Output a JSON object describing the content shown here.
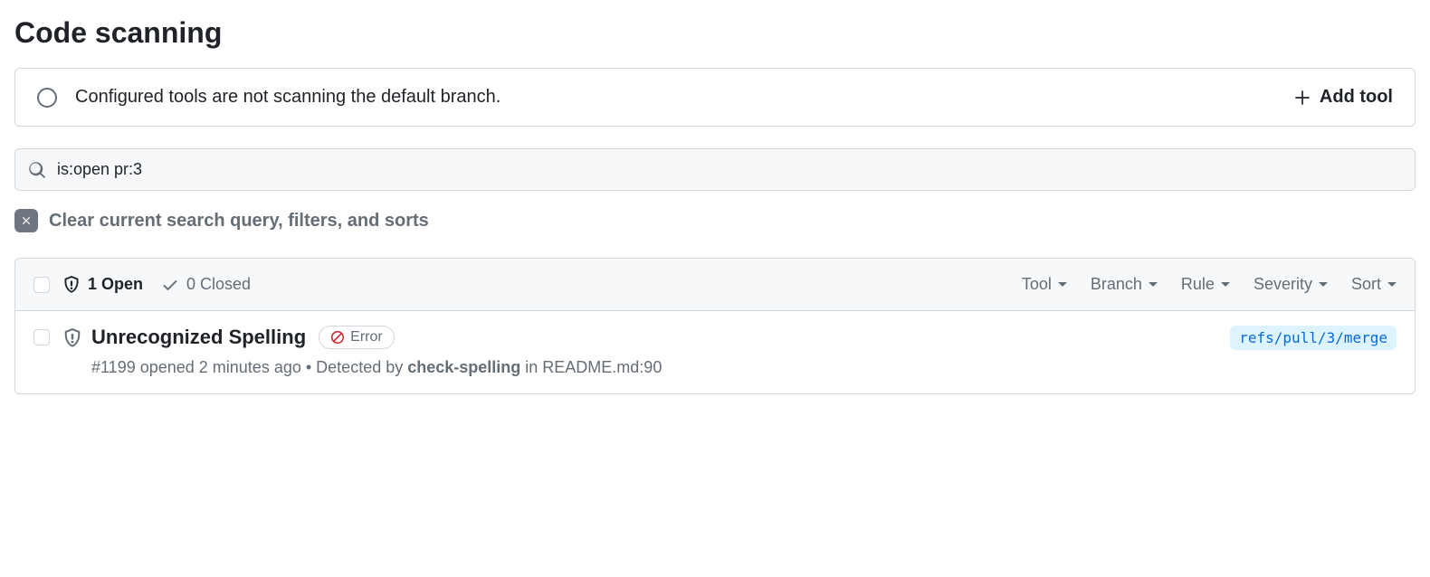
{
  "page": {
    "title": "Code scanning"
  },
  "banner": {
    "message": "Configured tools are not scanning the default branch.",
    "add_tool_label": "Add tool"
  },
  "search": {
    "value": "is:open pr:3"
  },
  "clear": {
    "label": "Clear current search query, filters, and sorts"
  },
  "list_header": {
    "open_label": "1 Open",
    "closed_label": "0 Closed",
    "filters": {
      "tool": "Tool",
      "branch": "Branch",
      "rule": "Rule",
      "severity": "Severity",
      "sort": "Sort"
    }
  },
  "alert": {
    "title": "Unrecognized Spelling",
    "severity_label": "Error",
    "meta_prefix": "#1199 opened 2 minutes ago",
    "meta_sep": " • ",
    "meta_detected": "Detected by ",
    "meta_tool": "check-spelling",
    "meta_location": " in README.md:90",
    "ref": "refs/pull/3/merge"
  }
}
